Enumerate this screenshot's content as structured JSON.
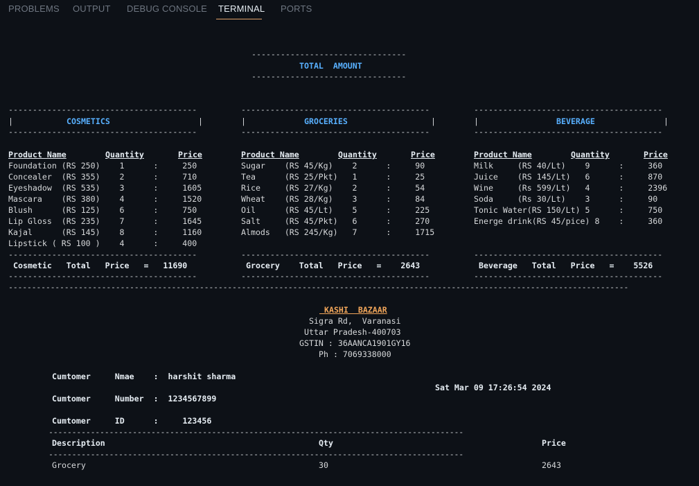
{
  "tabs": [
    {
      "label": "PROBLEMS"
    },
    {
      "label": "OUTPUT"
    },
    {
      "label": "DEBUG CONSOLE"
    },
    {
      "label": "TERMINAL",
      "active": true
    },
    {
      "label": "PORTS"
    }
  ],
  "header": {
    "dash_line": "--------------------------------",
    "title": "TOTAL  AMOUNT"
  },
  "dividers": {
    "section": "---------------------------------------",
    "wide": "-------------------------------------------------------------------------------------------------------------------------------------",
    "invoice": "-----------------------------------------------------------------------------------------"
  },
  "cosmetics": {
    "title": "COSMETICS",
    "pipe_left": "|",
    "pipe_right": "|",
    "col_product": "Product Name",
    "col_quantity": "Quantity",
    "col_price": "Price",
    "rows": [
      "Foundation (RS 250)    1      :     250",
      "Concealer  (RS 355)    2      :     710",
      "Eyeshadow  (RS 535)    3      :     1605",
      "Mascara    (RS 380)    4      :     1520",
      "Blush      (RS 125)    6      :     750",
      "Lip Gloss  (RS 235)    7      :     1645",
      "Kajal      (RS 145)    8      :     1160",
      "Lipstick ( RS 100 )    4      :     400"
    ],
    "total_line": "Cosmetic   Total   Price   =   11690"
  },
  "groceries": {
    "title": "GROCERIES",
    "pipe_left": "|",
    "pipe_right": "|",
    "col_product": "Product Name",
    "col_quantity": "Quantity",
    "col_price": "Price",
    "rows": [
      "Sugar    (RS 45/Kg)    2      :     90",
      "Tea      (RS 25/Pkt)   1      :     25",
      "Rice     (RS 27/Kg)    2      :     54",
      "Wheat    (RS 28/Kg)    3      :     84",
      "Oil      (RS 45/Lt)    5      :     225",
      "Salt     (RS 45/Pkt)   6      :     270",
      "Almods   (RS 245/Kg)   7      :     1715"
    ],
    "total_line": "Grocery    Total   Price   =    2643"
  },
  "beverage": {
    "title": "BEVERAGE",
    "pipe_left": "|",
    "pipe_right": "|",
    "col_product": "Product Name",
    "col_quantity": "Quantity",
    "col_price": "Price",
    "rows": [
      "Milk     (RS 40/Lt)    9      :     360",
      "Juice    (RS 145/Lt)   6      :     870",
      "Wine     (Rs 599/Lt)   4      :     2396",
      "Soda     (Rs 30/Lt)    3      :     90",
      "Tonic Water(RS 150/Lt) 5      :     750",
      "Energe drink(RS 45/pice) 8    :     360"
    ],
    "total_line": "Beverage   Total   Price   =    5526"
  },
  "shop": {
    "name": " KASHI  BAZAAR",
    "address1": "Sigra Rd,  Varanasi",
    "address2": "Uttar Pradesh-400703",
    "gstin": "GSTIN : 36AANCA1901GY16",
    "phone": "Ph : 7069338000"
  },
  "customer": {
    "name_line": "Cumtomer     Nmae    :  harshit sharma",
    "number_line": "Cumtomer     Number  :  1234567899",
    "id_line": "Cumtomer     ID      :     123456",
    "datetime": "Sat Mar 09 17:26:54 2024"
  },
  "invoice": {
    "col_description": "Description",
    "col_qty": "Qty",
    "col_price": "Price",
    "rows": [
      {
        "description": "Grocery",
        "qty": "30",
        "price": "2643"
      }
    ]
  }
}
